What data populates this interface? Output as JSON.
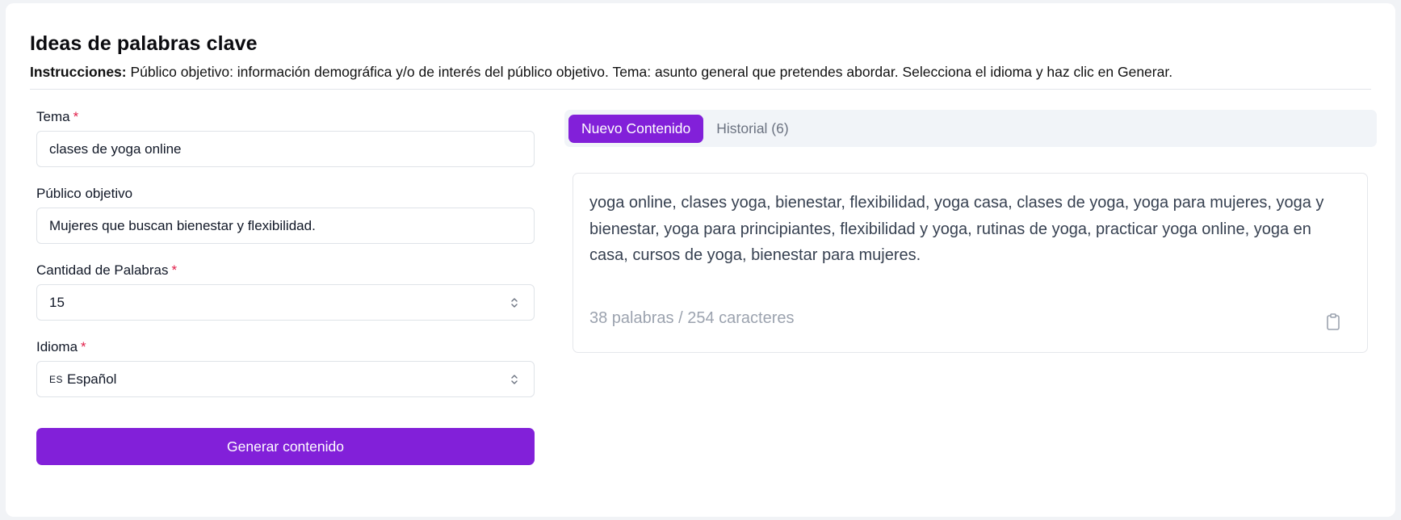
{
  "header": {
    "title": "Ideas de palabras clave",
    "instructions_label": "Instrucciones:",
    "instructions_text": " Público objetivo: información demográfica y/o de interés del público objetivo. Tema: asunto general que pretendes abordar. Selecciona el idioma y haz clic en Generar."
  },
  "form": {
    "tema": {
      "label": "Tema",
      "required_mark": "*",
      "value": "clases de yoga online"
    },
    "publico": {
      "label": "Público objetivo",
      "value": "Mujeres que buscan bienestar y flexibilidad."
    },
    "cantidad": {
      "label": "Cantidad de Palabras",
      "required_mark": "*",
      "value": "15"
    },
    "idioma": {
      "label": "Idioma",
      "required_mark": "*",
      "flag": "ES",
      "value": "Español"
    },
    "generate_label": "Generar contenido"
  },
  "tabs": {
    "new": "Nuevo Contenido",
    "history": "Historial (6)"
  },
  "output": {
    "text": "yoga online, clases yoga, bienestar, flexibilidad, yoga casa, clases de yoga, yoga para mujeres, yoga y bienestar, yoga para principiantes, flexibilidad y yoga, rutinas de yoga, practicar yoga online, yoga en casa, cursos de yoga, bienestar para mujeres.",
    "counter": "38 palabras / 254 caracteres"
  },
  "colors": {
    "accent": "#8220d9",
    "required": "#e11d48",
    "muted": "#9ca3af"
  },
  "icons": {
    "select": "chevron-up-down-icon",
    "copy": "clipboard-icon"
  }
}
